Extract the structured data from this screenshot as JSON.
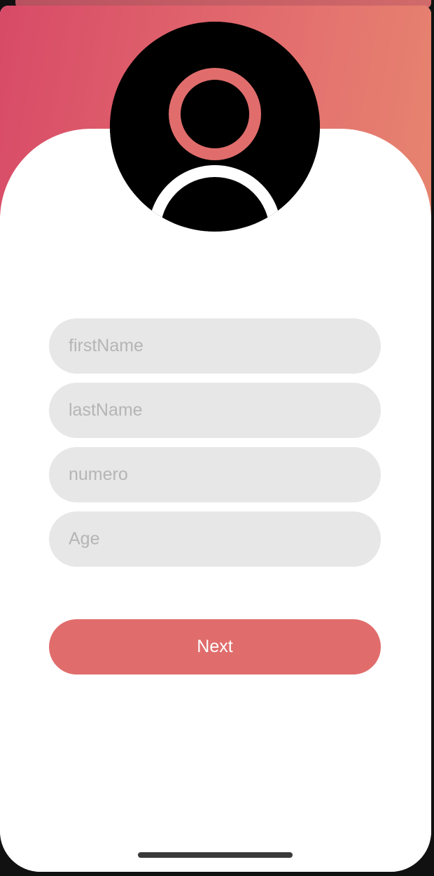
{
  "avatar": {
    "icon": "user-icon"
  },
  "form": {
    "fields": [
      {
        "placeholder": "firstName",
        "value": ""
      },
      {
        "placeholder": "lastName",
        "value": ""
      },
      {
        "placeholder": "numero",
        "value": ""
      },
      {
        "placeholder": "Age",
        "value": ""
      }
    ]
  },
  "actions": {
    "next_label": "Next"
  },
  "colors": {
    "gradient_start": "#d84a67",
    "gradient_end": "#e6846f",
    "accent": "#e06d6c",
    "field_bg": "#e7e7e7",
    "placeholder": "#b5b5b5"
  }
}
